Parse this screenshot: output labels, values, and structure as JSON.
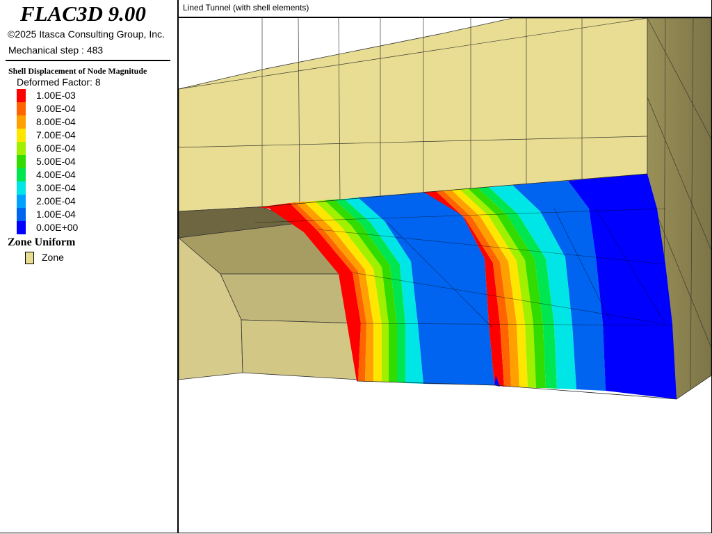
{
  "header": {
    "app_title": "FLAC3D 9.00",
    "copyright": "©2025 Itasca Consulting Group, Inc.",
    "step_text": "Mechanical step : 483"
  },
  "legend": {
    "plot_title": "Shell Displacement of Node Magnitude",
    "deformed_factor": "Deformed Factor: 8",
    "scale": [
      {
        "label": "1.00E-03",
        "color": "#ff0000"
      },
      {
        "label": "9.00E-04",
        "color": "#ff6400"
      },
      {
        "label": "8.00E-04",
        "color": "#ffa000"
      },
      {
        "label": "7.00E-04",
        "color": "#ffe600"
      },
      {
        "label": "6.00E-04",
        "color": "#a0f000"
      },
      {
        "label": "5.00E-04",
        "color": "#32dc00"
      },
      {
        "label": "4.00E-04",
        "color": "#00e650"
      },
      {
        "label": "3.00E-04",
        "color": "#00e6e6"
      },
      {
        "label": "2.00E-04",
        "color": "#00a0ff"
      },
      {
        "label": "1.00E-04",
        "color": "#0064f0"
      },
      {
        "label": "0.00E+00",
        "color": "#0000ff"
      }
    ],
    "zone_group_title": "Zone Uniform",
    "zone_label": "Zone",
    "zone_color": "#e8dd92"
  },
  "viewport": {
    "title": "Lined Tunnel (with shell elements)"
  }
}
